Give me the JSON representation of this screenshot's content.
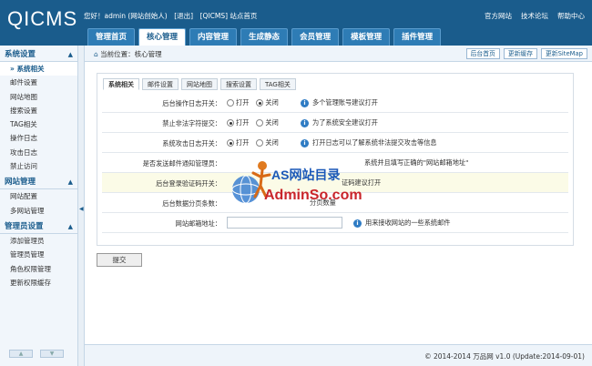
{
  "header": {
    "logo": "QICMS",
    "welcome": "您好！admin (网站创始人)　[退出]　[QICMS] 站点首页",
    "links": [
      "官方网站",
      "技术论坛",
      "帮助中心"
    ]
  },
  "nav": [
    "管理首页",
    "核心管理",
    "内容管理",
    "生成静态",
    "会员管理",
    "模板管理",
    "插件管理"
  ],
  "sidebar": {
    "groups": [
      {
        "title": "系统设置",
        "items": [
          "系统相关",
          "邮件设置",
          "网站地图",
          "搜索设置",
          "TAG相关",
          "操作日志",
          "攻击日志",
          "禁止访问"
        ]
      },
      {
        "title": "网站管理",
        "items": [
          "网站配置",
          "多网站管理"
        ]
      },
      {
        "title": "管理员设置",
        "items": [
          "添加管理员",
          "管理员管理",
          "角色权限管理",
          "更新权限缓存"
        ]
      }
    ]
  },
  "breadcrumb": {
    "text": "当前位置：核心管理",
    "buttons": [
      "后台首页",
      "更新缓存",
      "更新SiteMap"
    ]
  },
  "tabs": [
    "系统相关",
    "邮件设置",
    "网站地图",
    "搜索设置",
    "TAG相关"
  ],
  "rows": [
    {
      "label": "后台操作日志开关：",
      "on": "打开",
      "off": "关闭",
      "selected": "off",
      "tip": "多个管理账号建议打开"
    },
    {
      "label": "禁止非法字符提交：",
      "on": "打开",
      "off": "关闭",
      "selected": "on",
      "tip": "为了系统安全建议打开"
    },
    {
      "label": "系统攻击日志开关：",
      "on": "打开",
      "off": "关闭",
      "selected": "on",
      "tip": "打开日志可以了解系统非法提交攻击等信息"
    },
    {
      "label": "是否发送邮件通知管理员：",
      "tip": "系统并且填写正确的\"网站邮箱地址\""
    },
    {
      "label": "后台登录验证码开关：",
      "tip": "证码建议打开"
    },
    {
      "label": "后台数据分页条数：",
      "tip": "分页数量"
    },
    {
      "label": "网站邮箱地址：",
      "tip": "用来接收网站的一些系统邮件"
    }
  ],
  "submit": "提交",
  "footer": "© 2014-2014  万品网 v1.0 (Update:2014-09-01)",
  "watermark": {
    "line1": "AS网站目录",
    "line2": "AdminSo.com"
  }
}
